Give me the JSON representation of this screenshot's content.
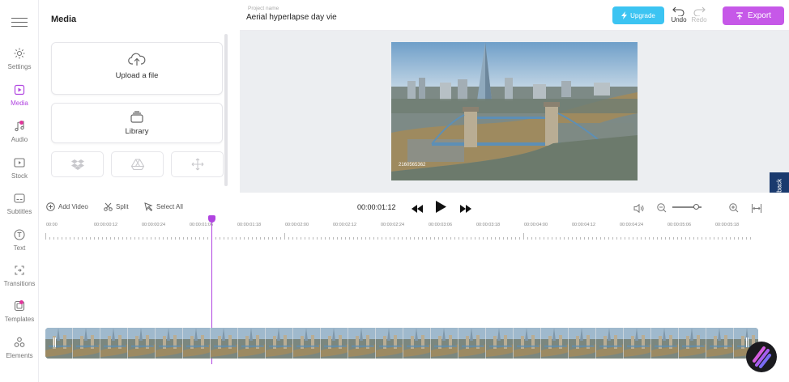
{
  "rail": {
    "items": [
      {
        "label": "Settings",
        "icon": "gear-icon"
      },
      {
        "label": "Media",
        "icon": "media-icon",
        "active": true
      },
      {
        "label": "Audio",
        "icon": "music-note-icon"
      },
      {
        "label": "Stock",
        "icon": "stock-video-icon"
      },
      {
        "label": "Subtitles",
        "icon": "subtitles-icon"
      },
      {
        "label": "Text",
        "icon": "text-icon"
      },
      {
        "label": "Transitions",
        "icon": "transitions-icon"
      },
      {
        "label": "Templates",
        "icon": "templates-icon"
      },
      {
        "label": "Elements",
        "icon": "elements-icon"
      }
    ]
  },
  "panel": {
    "title": "Media",
    "upload_label": "Upload a file",
    "library_label": "Library",
    "sources": [
      "dropbox-icon",
      "google-drive-icon",
      "link-icon"
    ]
  },
  "topbar": {
    "project_name_label": "Project name",
    "project_name_value": "Aerial hyperlapse day vie",
    "upgrade_label": "Upgrade",
    "undo_label": "Undo",
    "redo_label": "Redo",
    "export_label": "Export"
  },
  "preview": {
    "watermark": "2160565362"
  },
  "feedback_label": "Feedback",
  "timeline": {
    "add_video_label": "Add Video",
    "split_label": "Split",
    "select_all_label": "Select All",
    "timecode": "00:00:01:12",
    "ticks": [
      "00:00",
      "00:00:00:12",
      "00:00:00:24",
      "00:00:01:06",
      "00:00:01:18",
      "00:00:02:00",
      "00:00:02:12",
      "00:00:02:24",
      "00:00:03:06",
      "00:00:03:18",
      "00:00:04:00",
      "00:00:04:12",
      "00:00:04:24",
      "00:00:05:06",
      "00:00:05:18"
    ]
  },
  "colors": {
    "accent": "#b044e0",
    "export": "#c658e8",
    "upgrade": "#3cc4f2",
    "feedback": "#1a3a6e"
  }
}
